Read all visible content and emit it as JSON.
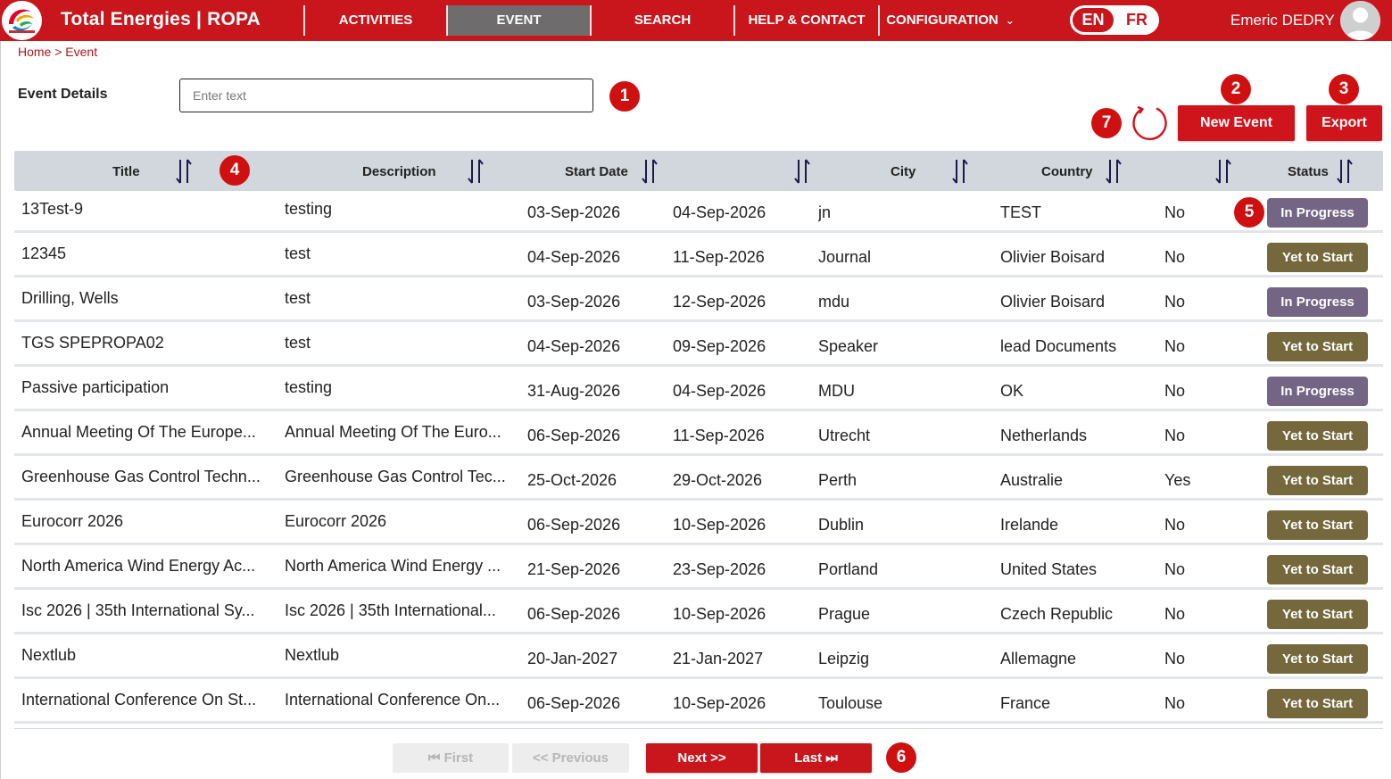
{
  "header": {
    "app_title": "Total Energies | ROPA",
    "nav": [
      {
        "label": "ACTIVITIES"
      },
      {
        "label": "EVENT"
      },
      {
        "label": "SEARCH"
      },
      {
        "label": "HELP & CONTACT"
      },
      {
        "label": "CONFIGURATION"
      }
    ],
    "lang_en": "EN",
    "lang_fr": "FR",
    "user_name": "Emeric DEDRY"
  },
  "breadcrumb": "Home > Event",
  "filter": {
    "label": "Event Details",
    "placeholder": "Enter text"
  },
  "actions": {
    "new_event": "New Event",
    "export": "Export"
  },
  "markers": [
    "1",
    "2",
    "3",
    "4",
    "5",
    "6",
    "7"
  ],
  "table": {
    "columns": [
      "Title",
      "Description",
      "Start Date",
      "City",
      "Country",
      "Status"
    ],
    "rows": [
      {
        "title": "13Test-9",
        "description": "testing",
        "start": "03-Sep-2026",
        "end": "04-Sep-2026",
        "city": "jn",
        "country": "TEST",
        "flag": "No",
        "status": "In Progress"
      },
      {
        "title": "12345",
        "description": "test",
        "start": "04-Sep-2026",
        "end": "11-Sep-2026",
        "city": "Journal",
        "country": "Olivier Boisard",
        "flag": "No",
        "status": "Yet to Start"
      },
      {
        "title": "Drilling, Wells",
        "description": "test",
        "start": "03-Sep-2026",
        "end": "12-Sep-2026",
        "city": "mdu",
        "country": "Olivier Boisard",
        "flag": "No",
        "status": "In Progress"
      },
      {
        "title": "TGS SPEPROPA02",
        "description": "test",
        "start": "04-Sep-2026",
        "end": "09-Sep-2026",
        "city": "Speaker",
        "country": "lead Documents",
        "flag": "No",
        "status": "Yet to Start"
      },
      {
        "title": "Passive participation",
        "description": "testing",
        "start": "31-Aug-2026",
        "end": "04-Sep-2026",
        "city": "MDU",
        "country": "OK",
        "flag": "No",
        "status": "In Progress"
      },
      {
        "title": "Annual Meeting Of The Europe...",
        "description": "Annual Meeting Of The Euro...",
        "start": "06-Sep-2026",
        "end": "11-Sep-2026",
        "city": "Utrecht",
        "country": "Netherlands",
        "flag": "No",
        "status": "Yet to Start"
      },
      {
        "title": "Greenhouse Gas Control Techn...",
        "description": "Greenhouse Gas Control Tec...",
        "start": "25-Oct-2026",
        "end": "29-Oct-2026",
        "city": "Perth",
        "country": "Australie",
        "flag": "Yes",
        "status": "Yet to Start"
      },
      {
        "title": "Eurocorr 2026",
        "description": "Eurocorr 2026",
        "start": "06-Sep-2026",
        "end": "10-Sep-2026",
        "city": "Dublin",
        "country": "Irelande",
        "flag": "No",
        "status": "Yet to Start"
      },
      {
        "title": "North America Wind Energy Ac...",
        "description": "North America Wind Energy ...",
        "start": "21-Sep-2026",
        "end": "23-Sep-2026",
        "city": "Portland",
        "country": "United States",
        "flag": "No",
        "status": "Yet to Start"
      },
      {
        "title": "Isc 2026 | 35th International Sy...",
        "description": "Isc 2026 | 35th International...",
        "start": "06-Sep-2026",
        "end": "10-Sep-2026",
        "city": "Prague",
        "country": "Czech Republic",
        "flag": "No",
        "status": "Yet to Start"
      },
      {
        "title": "Nextlub",
        "description": "Nextlub",
        "start": "20-Jan-2027",
        "end": "21-Jan-2027",
        "city": "Leipzig",
        "country": "Allemagne",
        "flag": "No",
        "status": "Yet to Start"
      },
      {
        "title": "International Conference On St...",
        "description": "International Conference On...",
        "start": "06-Sep-2026",
        "end": "10-Sep-2026",
        "city": "Toulouse",
        "country": "France",
        "flag": "No",
        "status": "Yet to Start"
      }
    ]
  },
  "pager": {
    "first": "⏮ First",
    "previous": "<< Previous",
    "next": "Next >>",
    "last": "Last ⏭"
  },
  "colors": {
    "brand_red": "#c8161c",
    "in_progress": "#756585",
    "yet_to_start": "#75683d",
    "header_row": "#d2d7dd"
  }
}
